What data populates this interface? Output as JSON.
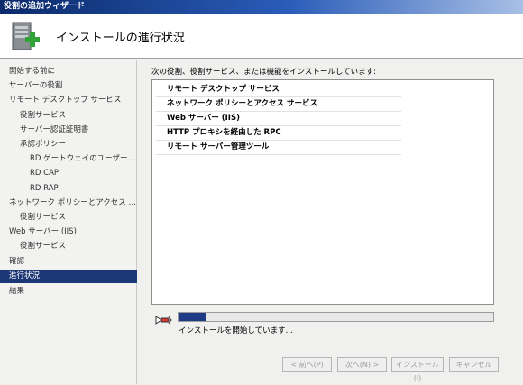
{
  "window": {
    "title": "役割の追加ウィザード"
  },
  "header": {
    "title": "インストールの進行状況",
    "icon": "server-add-icon"
  },
  "sidebar": {
    "items": [
      {
        "label": "開始する前に"
      },
      {
        "label": "サーバーの役割"
      },
      {
        "label": "リモート デスクトップ サービス"
      },
      {
        "label": "役割サービス"
      },
      {
        "label": "サーバー認証証明書"
      },
      {
        "label": "承認ポリシー"
      },
      {
        "label": "RD ゲートウェイのユーザー グ..."
      },
      {
        "label": "RD CAP"
      },
      {
        "label": "RD RAP"
      },
      {
        "label": "ネットワーク ポリシーとアクセス サービ..."
      },
      {
        "label": "役割サービス"
      },
      {
        "label": "Web サーバー (IIS)"
      },
      {
        "label": "役割サービス"
      },
      {
        "label": "確認"
      },
      {
        "label": "進行状況"
      },
      {
        "label": "結果"
      }
    ],
    "active_index": 14
  },
  "main": {
    "description": "次の役割、役割サービス、または機能をインストールしています:",
    "items": [
      "リモート デスクトップ サービス",
      "ネットワーク ポリシーとアクセス サービス",
      "Web サーバー (IIS)",
      "HTTP プロキシを経由した RPC",
      "リモート サーバー管理ツール"
    ],
    "progress_fraction": 0.09,
    "status": "インストールを開始しています..."
  },
  "buttons": {
    "prev": "< 前へ(P)",
    "next": "次へ(N) >",
    "install": "インストール(I)",
    "cancel": "キャンセル"
  }
}
